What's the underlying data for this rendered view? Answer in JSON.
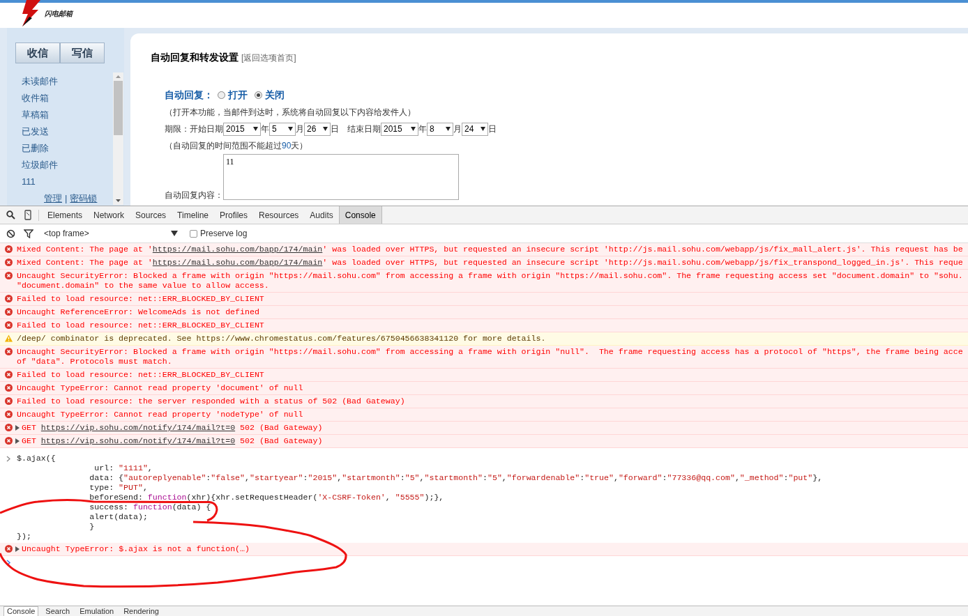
{
  "logo": {
    "text": "闪电邮箱"
  },
  "sidebar": {
    "buttons": [
      "收信",
      "写信"
    ],
    "folders": [
      "未读邮件",
      "收件箱",
      "草稿箱",
      "已发送",
      "已删除",
      "垃圾邮件",
      "111"
    ],
    "links": [
      "管理",
      "密码锁"
    ],
    "link_separator": "|"
  },
  "settings": {
    "title": "自动回复和转发设置",
    "back_link": "[返回选项首页]",
    "auto_reply": {
      "label": "自动回复：",
      "options": [
        {
          "label": "打开",
          "selected": false
        },
        {
          "label": "关闭",
          "selected": true
        }
      ]
    },
    "hint": "（打开本功能，当邮件到达时，系统将自动回复以下内容给发件人）",
    "period": {
      "label": "期限：开始日期",
      "end_label": "结束日期",
      "start": [
        {
          "value": "2015",
          "unit": "年"
        },
        {
          "value": "5",
          "unit": "月"
        },
        {
          "value": "26",
          "unit": "日"
        }
      ],
      "end": [
        {
          "value": "2015",
          "unit": "年"
        },
        {
          "value": "8",
          "unit": "月"
        },
        {
          "value": "24",
          "unit": "日"
        }
      ]
    },
    "note": [
      {
        "text": "（自动回复的时间范围不能超过",
        "highlight": false
      },
      {
        "text": "90",
        "highlight": true
      },
      {
        "text": "天）",
        "highlight": false
      }
    ],
    "content_label": "自动回复内容：",
    "content_value": "11"
  },
  "devtools": {
    "tabs": [
      {
        "label": "Elements",
        "selected": false
      },
      {
        "label": "Network",
        "selected": false
      },
      {
        "label": "Sources",
        "selected": false
      },
      {
        "label": "Timeline",
        "selected": false
      },
      {
        "label": "Profiles",
        "selected": false
      },
      {
        "label": "Resources",
        "selected": false
      },
      {
        "label": "Audits",
        "selected": false
      },
      {
        "label": "Console",
        "selected": true
      }
    ],
    "frame_select": "<top frame>",
    "preserve_log": {
      "label": "Preserve log",
      "checked": false
    },
    "messages": [
      {
        "kind": "error",
        "expandable": false,
        "lines": [
          [
            {
              "text": "Mixed Content: The page at '",
              "link": false
            },
            {
              "text": "https://mail.sohu.com/bapp/174/main",
              "link": true
            },
            {
              "text": "' was loaded over HTTPS, but requested an insecure script 'http://js.mail.sohu.com/webapp/js/fix_mall_alert.js'. This request has be",
              "link": false
            }
          ]
        ]
      },
      {
        "kind": "error",
        "expandable": false,
        "lines": [
          [
            {
              "text": "Mixed Content: The page at '",
              "link": false
            },
            {
              "text": "https://mail.sohu.com/bapp/174/main",
              "link": true
            },
            {
              "text": "' was loaded over HTTPS, but requested an insecure script 'http://js.mail.sohu.com/webapp/js/fix_transpond_logged_in.js'. This reque",
              "link": false
            }
          ]
        ]
      },
      {
        "kind": "error",
        "expandable": false,
        "lines": [
          [
            {
              "text": "Uncaught SecurityError: Blocked a frame with origin \"https://mail.sohu.com\" from accessing a frame with origin \"https://mail.sohu.com\". The frame requesting access set \"document.domain\" to \"sohu.",
              "link": false
            }
          ],
          [
            {
              "text": "\"document.domain\" to the same value to allow access.",
              "link": false
            }
          ]
        ]
      },
      {
        "kind": "error",
        "expandable": false,
        "lines": [
          [
            {
              "text": "Failed to load resource: net::ERR_BLOCKED_BY_CLIENT",
              "link": false
            }
          ]
        ]
      },
      {
        "kind": "error",
        "expandable": false,
        "lines": [
          [
            {
              "text": "Uncaught ReferenceError: WelcomeAds is not defined",
              "link": false
            }
          ]
        ]
      },
      {
        "kind": "error",
        "expandable": false,
        "lines": [
          [
            {
              "text": "Failed to load resource: net::ERR_BLOCKED_BY_CLIENT",
              "link": false
            }
          ]
        ]
      },
      {
        "kind": "warning",
        "expandable": false,
        "lines": [
          [
            {
              "text": "/deep/ combinator is deprecated. See https://www.chromestatus.com/features/6750456638341120 for more details.",
              "link": false
            }
          ]
        ]
      },
      {
        "kind": "error",
        "expandable": false,
        "lines": [
          [
            {
              "text": "Uncaught SecurityError: Blocked a frame with origin \"https://mail.sohu.com\" from accessing a frame with origin \"null\".  The frame requesting access has a protocol of \"https\", the frame being acce",
              "link": false
            }
          ],
          [
            {
              "text": "of \"data\". Protocols must match.",
              "link": false
            }
          ]
        ]
      },
      {
        "kind": "error",
        "expandable": false,
        "lines": [
          [
            {
              "text": "Failed to load resource: net::ERR_BLOCKED_BY_CLIENT",
              "link": false
            }
          ]
        ]
      },
      {
        "kind": "error",
        "expandable": false,
        "lines": [
          [
            {
              "text": "Uncaught TypeError: Cannot read property 'document' of null",
              "link": false
            }
          ]
        ]
      },
      {
        "kind": "error",
        "expandable": false,
        "lines": [
          [
            {
              "text": "Failed to load resource: the server responded with a status of 502 (Bad Gateway)",
              "link": false
            }
          ]
        ]
      },
      {
        "kind": "error",
        "expandable": false,
        "lines": [
          [
            {
              "text": "Uncaught TypeError: Cannot read property 'nodeType' of null",
              "link": false
            }
          ]
        ]
      },
      {
        "kind": "error",
        "expandable": true,
        "lines": [
          [
            {
              "text": "GET ",
              "link": false
            },
            {
              "text": "https://vip.sohu.com/notify/174/mail?t=0",
              "link": true
            },
            {
              "text": " 502 (Bad Gateway)",
              "link": false
            }
          ]
        ]
      },
      {
        "kind": "error",
        "expandable": true,
        "lines": [
          [
            {
              "text": "GET ",
              "link": false
            },
            {
              "text": "https://vip.sohu.com/notify/174/mail?t=0",
              "link": true
            },
            {
              "text": " 502 (Bad Gateway)",
              "link": false
            }
          ]
        ]
      }
    ],
    "command": [
      [
        {
          "text": "$.ajax({",
          "kind": "plain"
        }
      ],
      [
        {
          "text": "                url: ",
          "kind": "plain"
        },
        {
          "text": "\"1111\"",
          "kind": "string"
        },
        {
          "text": ",",
          "kind": "plain"
        }
      ],
      [
        {
          "text": "               data: {",
          "kind": "plain"
        },
        {
          "text": "\"autoreplyenable\"",
          "kind": "string"
        },
        {
          "text": ":",
          "kind": "plain"
        },
        {
          "text": "\"false\"",
          "kind": "string"
        },
        {
          "text": ",",
          "kind": "plain"
        },
        {
          "text": "\"startyear\"",
          "kind": "string"
        },
        {
          "text": ":",
          "kind": "plain"
        },
        {
          "text": "\"2015\"",
          "kind": "string"
        },
        {
          "text": ",",
          "kind": "plain"
        },
        {
          "text": "\"startmonth\"",
          "kind": "string"
        },
        {
          "text": ":",
          "kind": "plain"
        },
        {
          "text": "\"5\"",
          "kind": "string"
        },
        {
          "text": ",",
          "kind": "plain"
        },
        {
          "text": "\"startmonth\"",
          "kind": "string"
        },
        {
          "text": ":",
          "kind": "plain"
        },
        {
          "text": "\"5\"",
          "kind": "string"
        },
        {
          "text": ",",
          "kind": "plain"
        },
        {
          "text": "\"forwardenable\"",
          "kind": "string"
        },
        {
          "text": ":",
          "kind": "plain"
        },
        {
          "text": "\"true\"",
          "kind": "string"
        },
        {
          "text": ",",
          "kind": "plain"
        },
        {
          "text": "\"forward\"",
          "kind": "string"
        },
        {
          "text": ":",
          "kind": "plain"
        },
        {
          "text": "\"77336@qq.com\"",
          "kind": "string"
        },
        {
          "text": ",",
          "kind": "plain"
        },
        {
          "text": "\"_method\"",
          "kind": "string"
        },
        {
          "text": ":",
          "kind": "plain"
        },
        {
          "text": "\"put\"",
          "kind": "string"
        },
        {
          "text": "},",
          "kind": "plain"
        }
      ],
      [
        {
          "text": "               type: ",
          "kind": "plain"
        },
        {
          "text": "\"PUT\"",
          "kind": "string"
        },
        {
          "text": ",",
          "kind": "plain"
        }
      ],
      [
        {
          "text": "               beforeSend: ",
          "kind": "plain"
        },
        {
          "text": "function",
          "kind": "keyword"
        },
        {
          "text": "(xhr){xhr.setRequestHeader(",
          "kind": "plain"
        },
        {
          "text": "'X-CSRF-Token'",
          "kind": "string"
        },
        {
          "text": ", ",
          "kind": "plain"
        },
        {
          "text": "\"5555\"",
          "kind": "string"
        },
        {
          "text": ");},",
          "kind": "plain"
        }
      ],
      [
        {
          "text": "               success: ",
          "kind": "plain"
        },
        {
          "text": "function",
          "kind": "keyword"
        },
        {
          "text": "(data) {",
          "kind": "plain"
        }
      ],
      [
        {
          "text": "               alert(data);",
          "kind": "plain"
        }
      ],
      [
        {
          "text": "               }",
          "kind": "plain"
        }
      ],
      [
        {
          "text": "});",
          "kind": "plain"
        }
      ]
    ],
    "result": {
      "kind": "error",
      "expandable": true,
      "lines": [
        [
          {
            "text": "Uncaught TypeError: $.ajax is not a function(…)",
            "link": false
          }
        ]
      ]
    },
    "drawer_tabs": [
      {
        "label": "Console",
        "selected": true
      },
      {
        "label": "Search",
        "selected": false
      },
      {
        "label": "Emulation",
        "selected": false
      },
      {
        "label": "Rendering",
        "selected": false
      }
    ]
  }
}
